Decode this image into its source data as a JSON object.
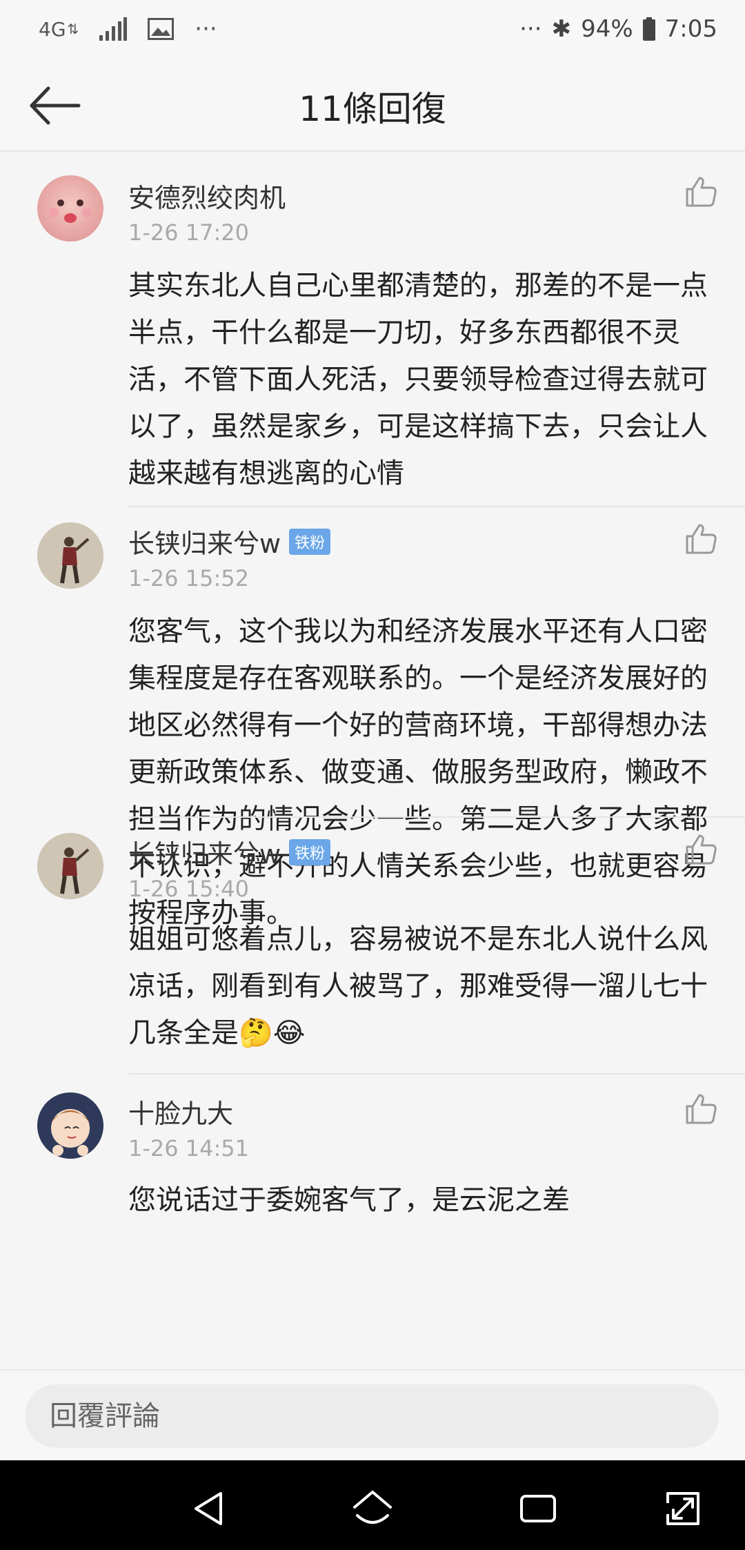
{
  "status": {
    "network": "4G",
    "battery": "94%",
    "time": "7:05",
    "dots_left": "···",
    "dots_right": "···"
  },
  "header": {
    "title": "11條回復"
  },
  "comments": [
    {
      "name": "安德烈绞肉机",
      "badge": "",
      "time": "1-26 17:20",
      "text": "其实东北人自己心里都清楚的，那差的不是一点半点，干什么都是一刀切，好多东西都很不灵活，不管下面人死活，只要领导检查过得去就可以了，虽然是家乡，可是这样搞下去，只会让人越来越有想逃离的心情"
    },
    {
      "name": "长铗归来兮w",
      "badge": "铁粉",
      "time": "1-26 15:52",
      "text": "您客气，这个我以为和经济发展水平还有人口密集程度是存在客观联系的。一个是经济发展好的地区必然得有一个好的营商环境，干部得想办法更新政策体系、做变通、做服务型政府，懒政不担当作为的情况会少一些。第二是人多了大家都不认识，避不开的人情关系会少些，也就更容易按程序办事。"
    },
    {
      "name": "长铗归来兮w",
      "badge": "铁粉",
      "time": "1-26 15:40",
      "text": "姐姐可悠着点儿，容易被说不是东北人说什么风凉话，刚看到有人被骂了，那难受得一溜儿七十几条全是🤔😂"
    },
    {
      "name": "十脸九大",
      "badge": "",
      "time": "1-26 14:51",
      "text": "您说话过于委婉客气了，是云泥之差"
    }
  ],
  "reply": {
    "placeholder": "回覆評論"
  },
  "colors": {
    "background": "#f5f5f5",
    "badge": "#6aa6e8",
    "time_text": "#a9a9a9"
  }
}
